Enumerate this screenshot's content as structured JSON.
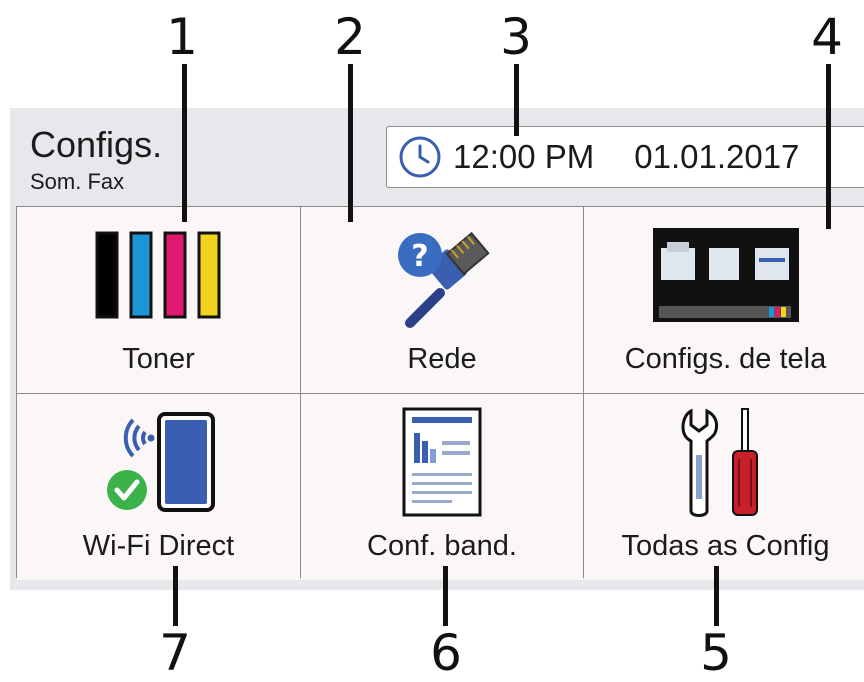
{
  "header": {
    "title": "Configs.",
    "subtitle": "Som. Fax",
    "time": "12:00 PM",
    "date": "01.01.2017"
  },
  "tiles": [
    {
      "label": "Toner",
      "icon": "toner-icon"
    },
    {
      "label": "Rede",
      "icon": "network-icon"
    },
    {
      "label": "Configs. de tela",
      "icon": "screen-settings-icon"
    },
    {
      "label": "Wi-Fi Direct",
      "icon": "wifi-direct-icon"
    },
    {
      "label": "Conf. band.",
      "icon": "tray-settings-icon"
    },
    {
      "label": "Todas as Config",
      "icon": "all-settings-icon"
    }
  ],
  "callouts": [
    "1",
    "2",
    "3",
    "4",
    "5",
    "6",
    "7"
  ],
  "colors": {
    "toner_black": "#000000",
    "toner_cyan": "#1a96d6",
    "toner_magenta": "#e0186e",
    "toner_yellow": "#f1d21e",
    "accent_blue": "#3a5fb0",
    "check_green": "#3bb24a",
    "screwdriver_red": "#c8202a"
  }
}
